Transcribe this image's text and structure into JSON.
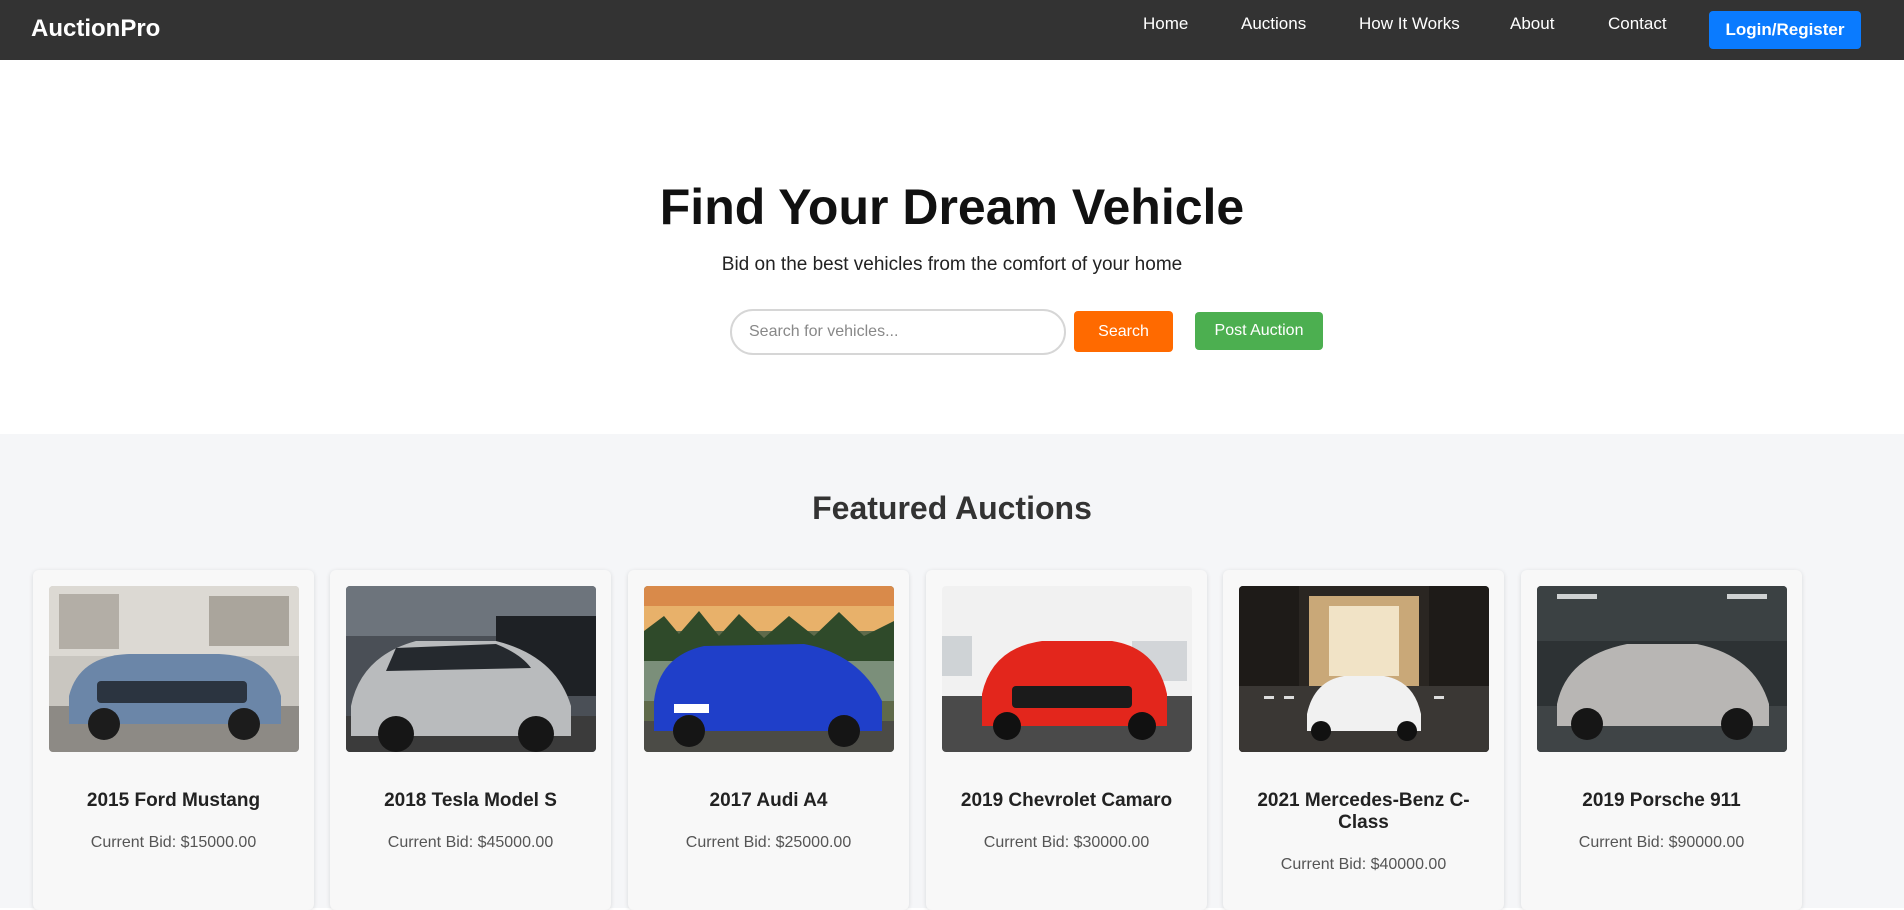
{
  "nav": {
    "brand": "AuctionPro",
    "links": [
      "Home",
      "Auctions",
      "How It Works",
      "About",
      "Contact"
    ],
    "login_label": "Login/Register"
  },
  "hero": {
    "title": "Find Your Dream Vehicle",
    "subtitle": "Bid on the best vehicles from the comfort of your home",
    "search_placeholder": "Search for vehicles...",
    "search_label": "Search",
    "post_label": "Post Auction"
  },
  "featured": {
    "title": "Featured Auctions",
    "items": [
      {
        "title": "2015 Ford Mustang",
        "bid": "Current Bid: $15000.00",
        "car_color": "#6b86a8"
      },
      {
        "title": "2018 Tesla Model S",
        "bid": "Current Bid: $45000.00",
        "car_color": "#b9bbbd"
      },
      {
        "title": "2017 Audi A4",
        "bid": "Current Bid: $25000.00",
        "car_color": "#1f3fc9"
      },
      {
        "title": "2019 Chevrolet Camaro",
        "bid": "Current Bid: $30000.00",
        "car_color": "#e3261c"
      },
      {
        "title": "2021 Mercedes-Benz C-Class",
        "bid": "Current Bid: $40000.00",
        "car_color": "#f1f1f1"
      },
      {
        "title": "2019 Porsche 911",
        "bid": "Current Bid: $90000.00",
        "car_color": "#b8b6b4"
      }
    ]
  },
  "colors": {
    "navbar": "#333333",
    "login_button": "#0a7bff",
    "search_button": "#ff6a00",
    "post_button": "#4caf50",
    "featured_bg": "#f5f6f8"
  }
}
